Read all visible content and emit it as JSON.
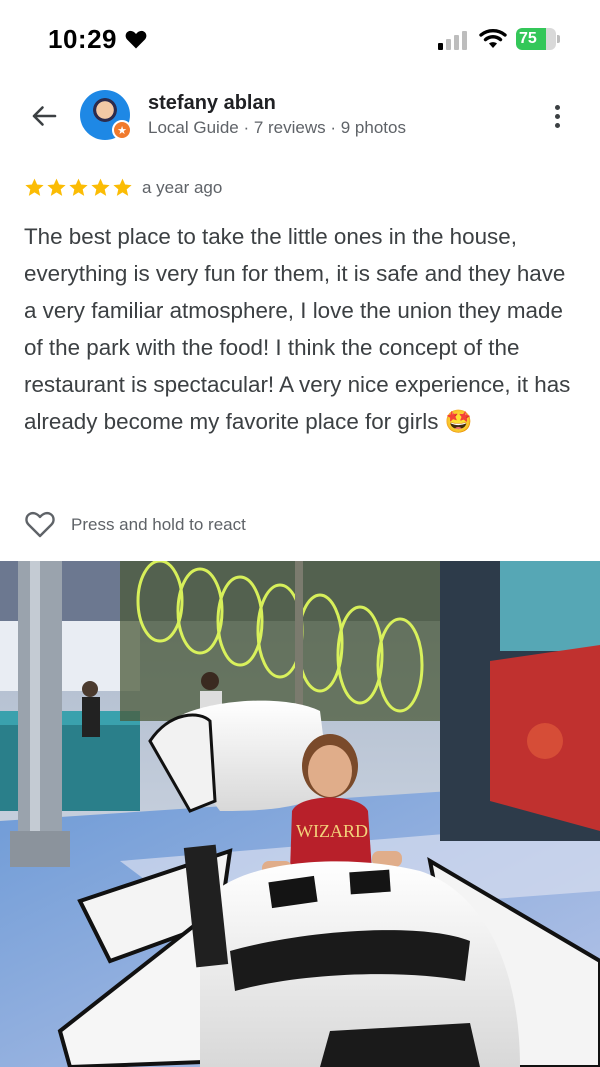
{
  "status_bar": {
    "time": "10:29",
    "battery": "75",
    "battery_level": 0.75,
    "icons": [
      "heart-icon",
      "signal-icon",
      "wifi-icon",
      "battery-icon"
    ]
  },
  "header": {
    "back_icon": "arrow-left-icon",
    "user_name": "stefany ablan",
    "user_meta": "Local Guide · 7 reviews · 9 photos",
    "more_icon": "more-vertical-icon"
  },
  "review": {
    "rating": 5,
    "rating_max": 5,
    "date": "a year ago",
    "text": "The best place to take the little ones in the house, everything is very fun for them, it is safe and they have a very familiar atmosphere, I love the union they made of the park with the food! I think the concept of the restaurant is spectacular! A very nice experience, it has already become my favorite place for girls 🤩"
  },
  "react": {
    "label": "Press and hold to react",
    "icon": "heart-outline-icon"
  },
  "photo": {
    "shirt_text": "WIZARD"
  },
  "colors": {
    "star": "#fbbc04",
    "battery": "#34c759",
    "badge": "#f07a2d"
  }
}
